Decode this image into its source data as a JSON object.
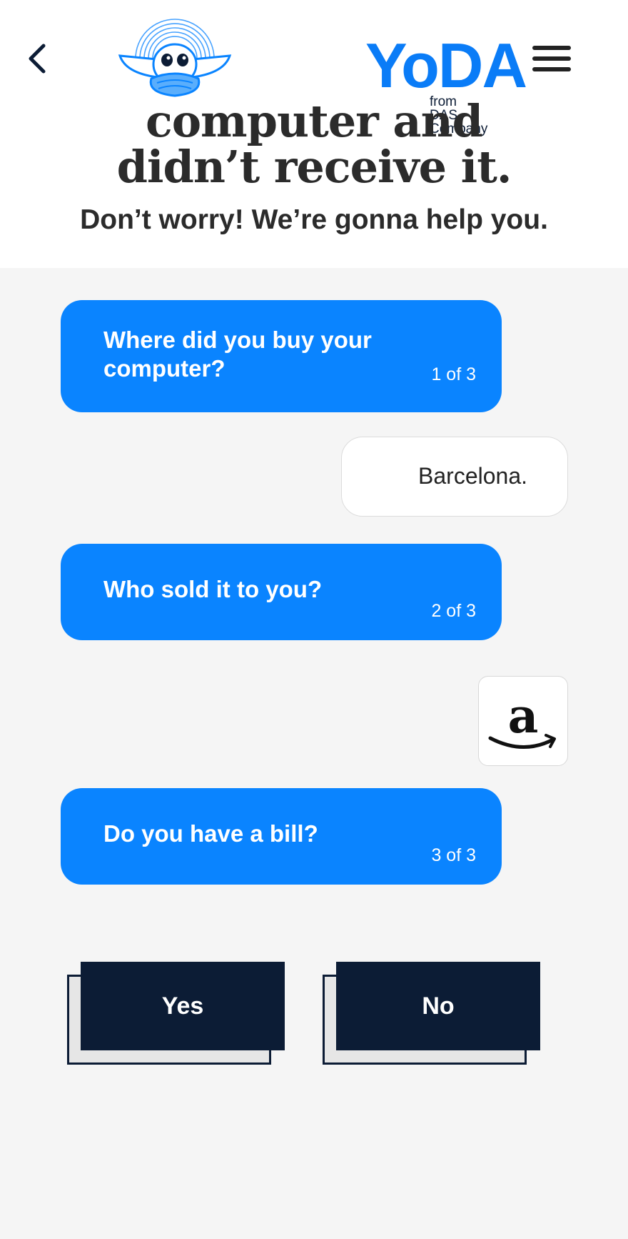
{
  "header": {
    "brand_name": "YoDA",
    "brand_sub": "from DAS Company",
    "headline_line1": "computer and",
    "headline_line2": "didn’t receive it.",
    "subhead": "Don’t worry! We’re gonna help you."
  },
  "icons": {
    "back": "chevron-left-icon",
    "menu": "hamburger-menu-icon",
    "logo": "yoda-mascot-logo"
  },
  "colors": {
    "accent": "#0a84ff",
    "navy": "#0c1c35",
    "page_bg": "#f5f5f5"
  },
  "chat": {
    "q1": {
      "text": "Where did you buy your computer?",
      "count": "1 of 3"
    },
    "a1": {
      "text": "Barcelona."
    },
    "q2": {
      "text": "Who sold it to you?",
      "count": "2 of 3"
    },
    "a2": {
      "logo": "amazon-logo",
      "letter": "a"
    },
    "q3": {
      "text": "Do you have a bill?",
      "count": "3 of 3"
    }
  },
  "actions": {
    "yes_label": "Yes",
    "no_label": "No"
  }
}
